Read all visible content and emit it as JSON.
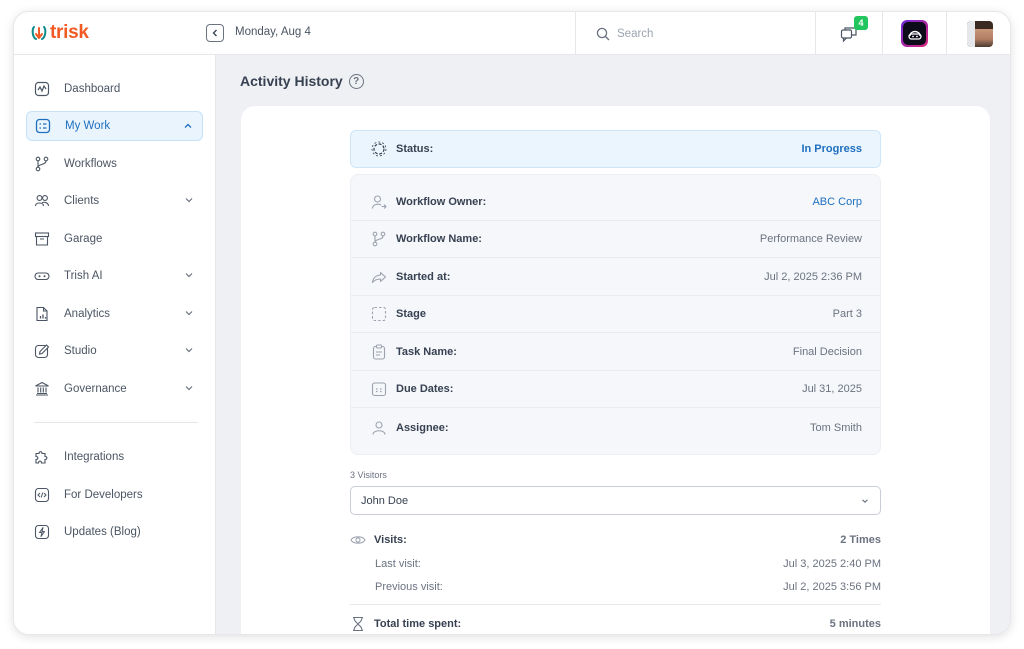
{
  "app": {
    "logo_text": "trisk",
    "date": "Monday, Aug 4",
    "search_placeholder": "Search",
    "notifications_count": "4"
  },
  "colors": {
    "brand_orange": "#f15a24",
    "brand_teal": "#0f8b8d",
    "accent_blue": "#1e6fbf",
    "active_bg": "#eaf4fd",
    "badge_green": "#22c55e"
  },
  "sidebar": {
    "items": [
      {
        "label": "Dashboard",
        "icon": "dashboard-icon",
        "chevron": ""
      },
      {
        "label": "My Work",
        "icon": "my-work-icon",
        "chevron": "up",
        "active": true
      },
      {
        "label": "Workflows",
        "icon": "workflows-icon",
        "chevron": ""
      },
      {
        "label": "Clients",
        "icon": "clients-icon",
        "chevron": "down"
      },
      {
        "label": "Garage",
        "icon": "garage-icon",
        "chevron": ""
      },
      {
        "label": "Trish AI",
        "icon": "trish-ai-icon",
        "chevron": "down"
      },
      {
        "label": "Analytics",
        "icon": "analytics-icon",
        "chevron": "down"
      },
      {
        "label": "Studio",
        "icon": "studio-icon",
        "chevron": "down"
      },
      {
        "label": "Governance",
        "icon": "governance-icon",
        "chevron": "down"
      },
      {
        "label": "Integrations",
        "icon": "integrations-icon",
        "chevron": ""
      },
      {
        "label": "For Developers",
        "icon": "developers-icon",
        "chevron": ""
      },
      {
        "label": "Updates (Blog)",
        "icon": "updates-icon",
        "chevron": ""
      }
    ]
  },
  "main": {
    "title": "Activity History",
    "status": {
      "label": "Status:",
      "value": "In Progress"
    },
    "details": [
      {
        "label": "Workflow Owner:",
        "value": "ABC Corp",
        "icon": "owner-icon"
      },
      {
        "label": "Workflow Name:",
        "value": "Performance Review",
        "icon": "workflow-icon"
      },
      {
        "label": "Started at:",
        "value": "Jul 2, 2025 2:36 PM",
        "icon": "started-icon"
      },
      {
        "label": "Stage",
        "value": "Part 3",
        "icon": "stage-icon"
      },
      {
        "label": "Task Name:",
        "value": "Final Decision",
        "icon": "task-icon"
      },
      {
        "label": "Due Dates:",
        "value": "Jul 31, 2025",
        "icon": "calendar-icon"
      },
      {
        "label": "Assignee:",
        "value": "Tom Smith",
        "icon": "user-icon"
      }
    ],
    "visitors_label": "3 Visitors",
    "selected_visitor": "John Doe",
    "visits": {
      "label": "Visits:",
      "value": "2 Times"
    },
    "last_visit": {
      "label": "Last visit:",
      "value": "Jul 3, 2025 2:40 PM"
    },
    "previous_visit": {
      "label": "Previous visit:",
      "value": "Jul 2, 2025 3:56 PM"
    },
    "total_time": {
      "label": "Total time spent:",
      "value": "5 minutes"
    }
  }
}
